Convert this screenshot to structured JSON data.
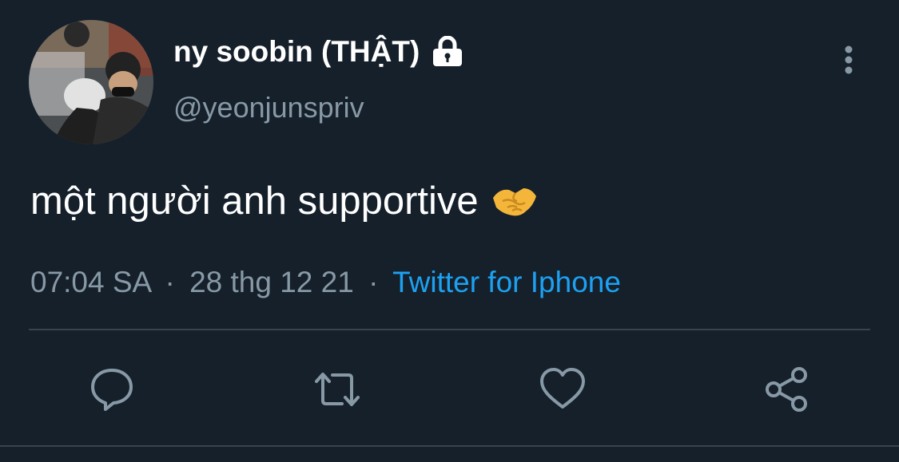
{
  "tweet": {
    "author": {
      "display_name": "ny soobin (THẬT)",
      "handle": "@yeonjunspriv",
      "avatar_icon": "profile-photo",
      "protected_icon": "lock-icon"
    },
    "text": "một người anh supportive",
    "emoji": "handshake-emoji",
    "time": "07:04 SA",
    "date": "28 thg 12 21",
    "separator": "·",
    "source": "Twitter for Iphone",
    "menu_icon": "more-vertical-icon"
  },
  "actions": [
    {
      "name": "reply",
      "icon": "reply-icon"
    },
    {
      "name": "retweet",
      "icon": "retweet-icon"
    },
    {
      "name": "like",
      "icon": "heart-icon"
    },
    {
      "name": "share",
      "icon": "share-icon"
    }
  ],
  "colors": {
    "background": "#15202b",
    "primary_text": "#ffffff",
    "secondary_text": "#8899a6",
    "accent": "#1da1f2",
    "divider": "#38444d"
  }
}
